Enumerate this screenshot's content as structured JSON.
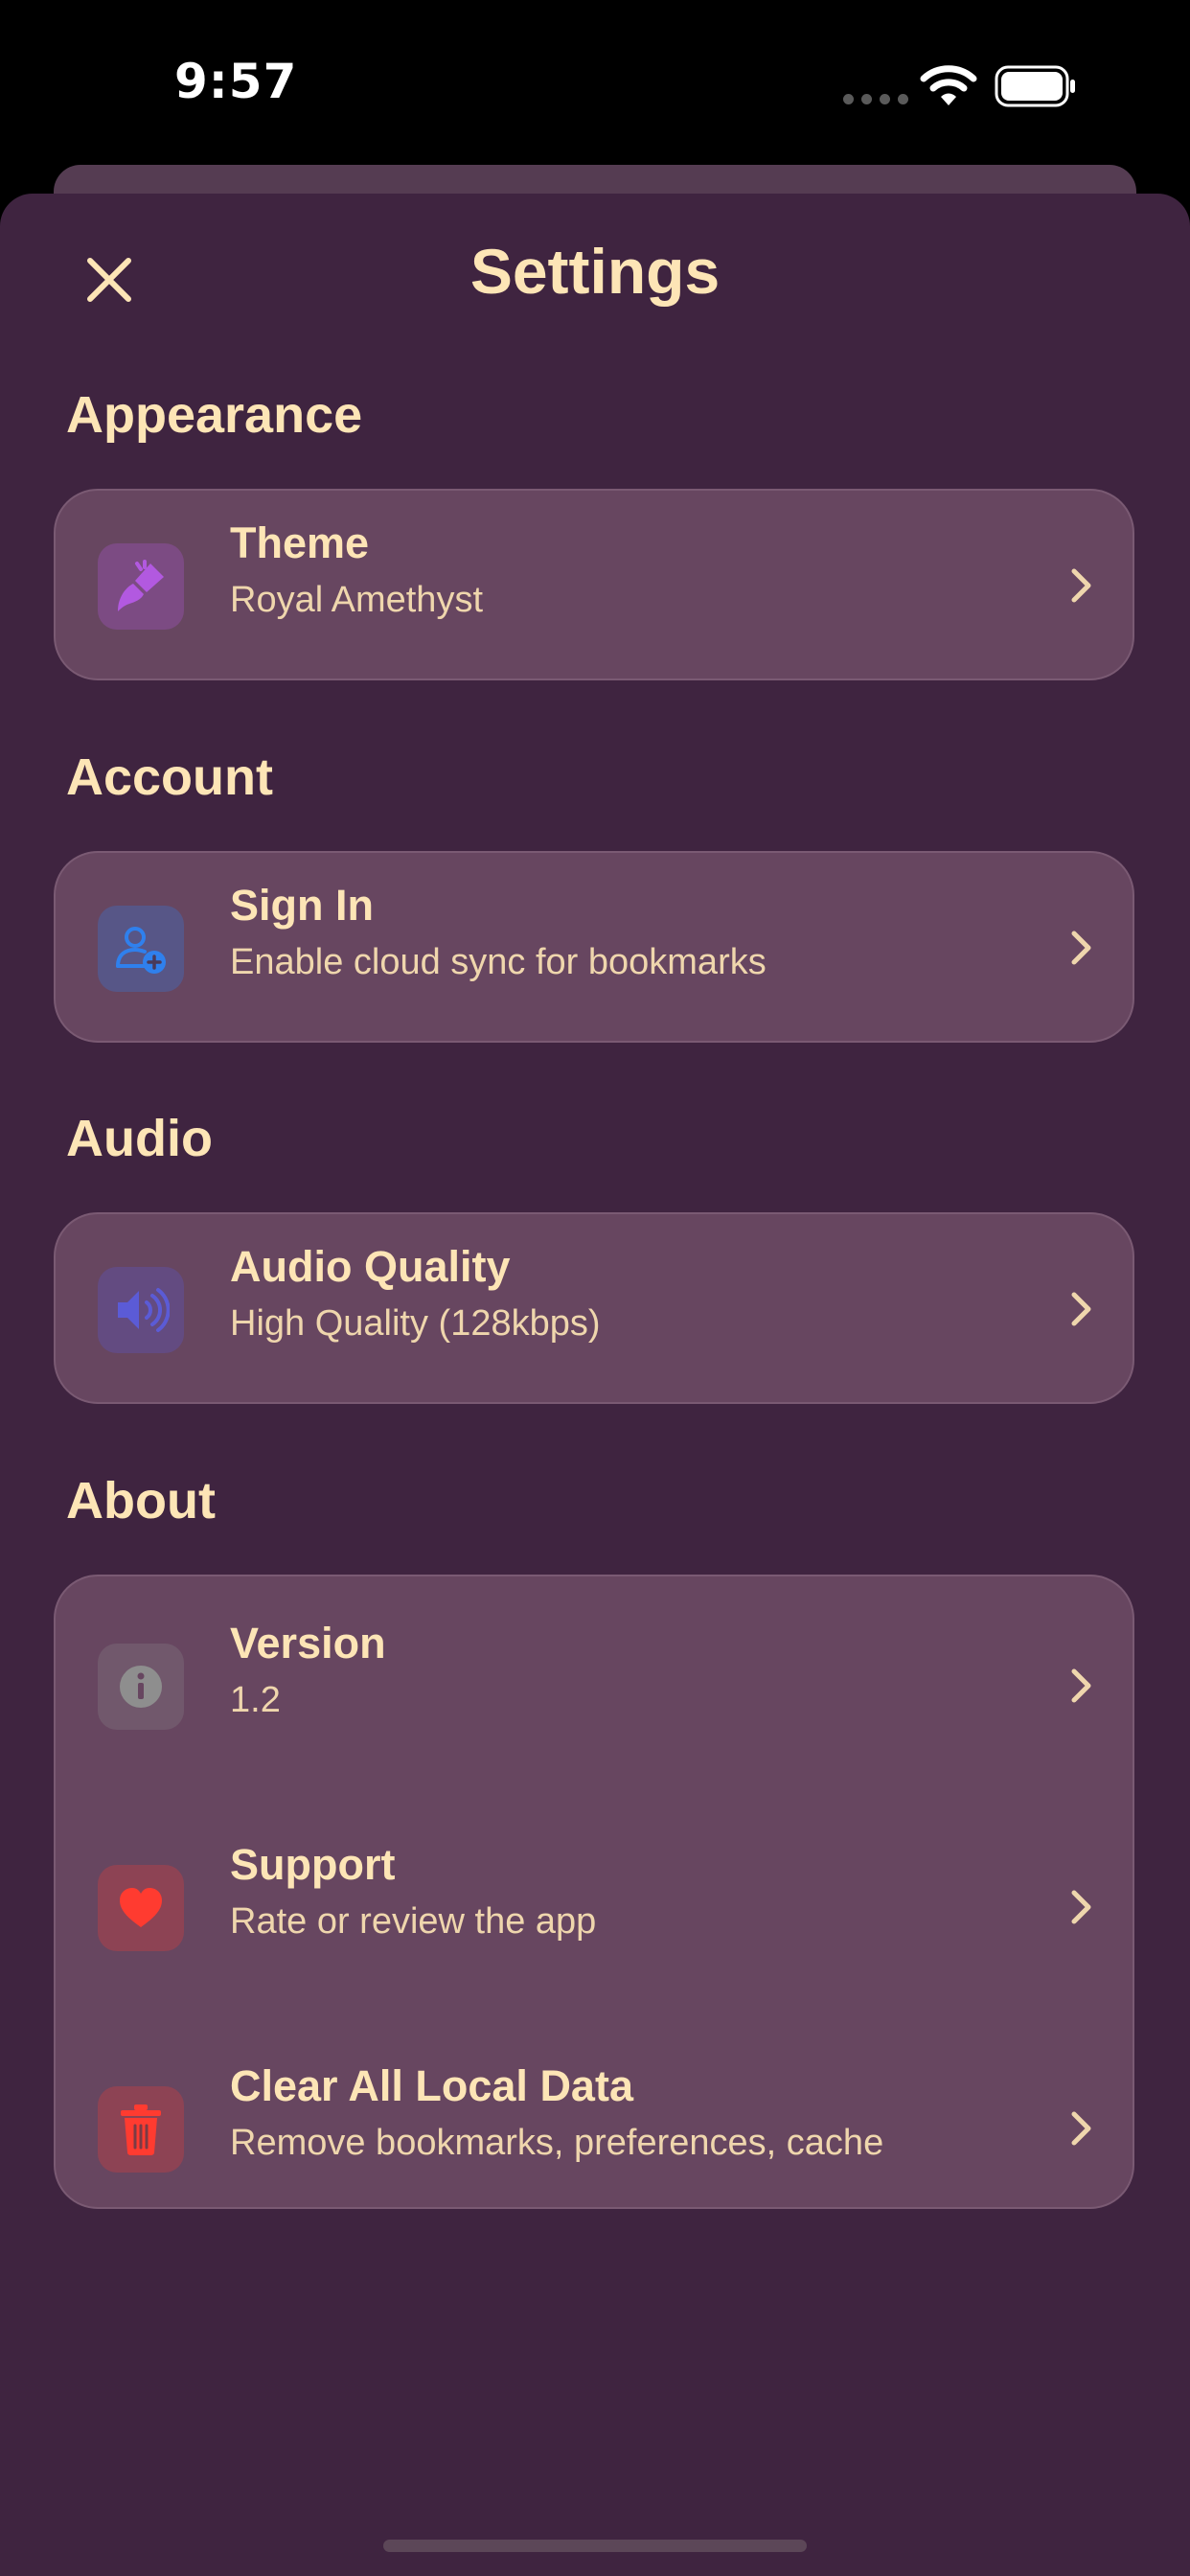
{
  "status_bar": {
    "time": "9:57"
  },
  "header": {
    "title": "Settings"
  },
  "sections": {
    "appearance": {
      "title": "Appearance",
      "rows": [
        {
          "title": "Theme",
          "subtitle": "Royal Amethyst",
          "icon": "paintbrush-icon",
          "icon_color": "#b259e0"
        }
      ]
    },
    "account": {
      "title": "Account",
      "rows": [
        {
          "title": "Sign In",
          "subtitle": "Enable cloud sync for bookmarks",
          "icon": "person-add-icon",
          "icon_color": "#2f80ed"
        }
      ]
    },
    "audio": {
      "title": "Audio",
      "rows": [
        {
          "title": "Audio Quality",
          "subtitle": "High Quality (128kbps)",
          "icon": "speaker-icon",
          "icon_color": "#5b5bd6"
        }
      ]
    },
    "about": {
      "title": "About",
      "rows": [
        {
          "title": "Version",
          "subtitle": "1.2",
          "icon": "info-icon",
          "icon_color": "#8e8e8e"
        },
        {
          "title": "Support",
          "subtitle": "Rate or review the app",
          "icon": "heart-icon",
          "icon_color": "#ff3b30"
        },
        {
          "title": "Clear All Local Data",
          "subtitle": "Remove bookmarks, preferences, cache",
          "icon": "trash-icon",
          "icon_color": "#ff3b30"
        }
      ]
    }
  },
  "colors": {
    "background": "#3f2440",
    "card": "#674660",
    "text": "#fde5b6"
  }
}
